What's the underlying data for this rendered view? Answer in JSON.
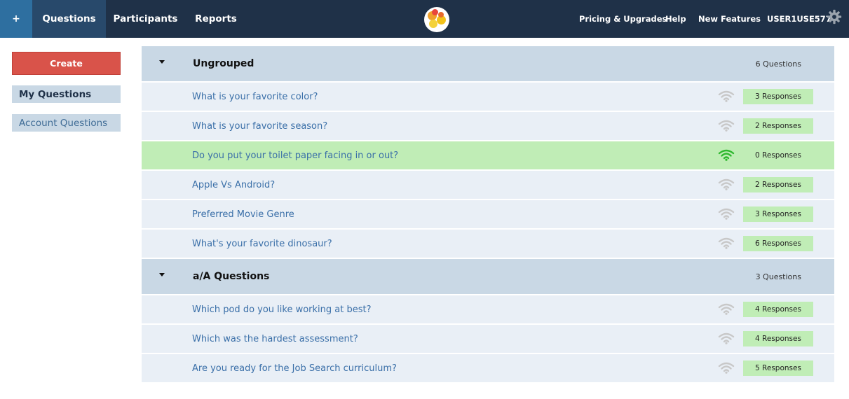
{
  "topbar": {
    "plus_label": "+",
    "tabs": [
      {
        "label": "Questions",
        "active": true
      },
      {
        "label": "Participants",
        "active": false
      },
      {
        "label": "Reports",
        "active": false
      }
    ],
    "right_links": {
      "pricing": "Pricing & Upgrades",
      "help": "Help",
      "new_features": "New Features",
      "username": "USER1USE577"
    },
    "logo_icon": "colorful-dots-logo",
    "settings_icon": "gear-icon"
  },
  "sidebar": {
    "create_label": "Create",
    "my_questions": "My Questions",
    "account_questions": "Account Questions"
  },
  "colors": {
    "topbar_bg": "#1f3148",
    "active_tab_bg": "#28496b",
    "plus_bg": "#2e6fa0",
    "create_bg": "#d9534a",
    "header_bg": "#c9d8e5",
    "row_bg": "#e9eff6",
    "active_row_bg": "#c0edb6",
    "badge_bg": "#c0edb6",
    "link": "#3a6fa8",
    "wifi_inactive": "#c8c8c8",
    "wifi_active": "#2fb82f"
  },
  "groups": [
    {
      "title": "Ungrouped",
      "count": "6 Questions",
      "questions": [
        {
          "text": "What is your favorite color?",
          "responses": "3 Responses",
          "active": false
        },
        {
          "text": "What is your favorite season?",
          "responses": "2 Responses",
          "active": false
        },
        {
          "text": "Do you put your toilet paper facing in or out?",
          "responses": "0 Responses",
          "active": true
        },
        {
          "text": "Apple Vs Android?",
          "responses": "2 Responses",
          "active": false
        },
        {
          "text": "Preferred Movie Genre",
          "responses": "3 Responses",
          "active": false
        },
        {
          "text": "What's your favorite dinosaur?",
          "responses": "6 Responses",
          "active": false
        }
      ]
    },
    {
      "title": "a/A Questions",
      "count": "3 Questions",
      "questions": [
        {
          "text": "Which pod do you like working at best?",
          "responses": "4 Responses",
          "active": false
        },
        {
          "text": "Which was the hardest assessment?",
          "responses": "4 Responses",
          "active": false
        },
        {
          "text": "Are you ready for the Job Search curriculum?",
          "responses": "5 Responses",
          "active": false
        }
      ]
    }
  ]
}
